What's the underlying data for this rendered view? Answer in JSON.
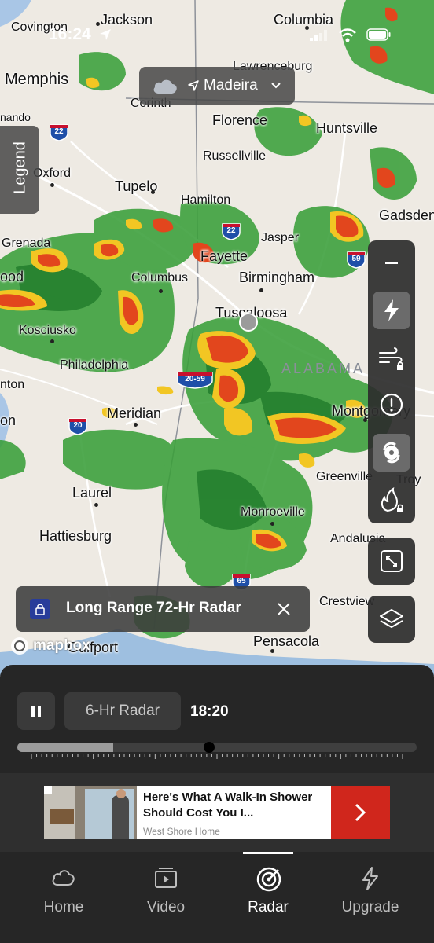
{
  "status_bar": {
    "time": "16:24"
  },
  "location": {
    "name": "Madeira"
  },
  "legend": {
    "label": "Legend"
  },
  "map": {
    "attribution": "mapbox",
    "state_label": "ALABAMA",
    "cities": [
      "Covington",
      "Jackson",
      "Columbia",
      "Lawrenceburg",
      "Memphis",
      "Corinth",
      "Florence",
      "Huntsville",
      "nando",
      "Russellville",
      "Oxford",
      "Tupelo",
      "Hamilton",
      "Gadsden",
      "Grenada",
      "Jasper",
      "Fayette",
      "ood",
      "Columbus",
      "Birmingham",
      "Tuscaloosa",
      "Kosciusko",
      "Philadelphia",
      "nton",
      "Meridian",
      "Montgomery",
      "on",
      "Greenville",
      "Troy",
      "Laurel",
      "Monroeville",
      "Hattiesburg",
      "Andalusia",
      "Crestview",
      "Pensacola",
      "Gulfport"
    ],
    "highways": [
      "22",
      "22",
      "59",
      "20-59",
      "20",
      "65"
    ]
  },
  "long_range": {
    "label": "Long Range 72-Hr Radar"
  },
  "controls": {
    "radar_mode": "6-Hr Radar",
    "time": "18:20",
    "progress": 0.24,
    "marker": 0.48
  },
  "ad": {
    "headline": "Here's What A Walk-In Shower Should Cost You I...",
    "advertiser": "West Shore Home"
  },
  "tabs": [
    "Home",
    "Video",
    "Radar",
    "Upgrade"
  ],
  "active_tab": "Radar",
  "colors": {
    "accent": "#ffffff",
    "ad_arrow": "#d0261c",
    "radar_green": "#3aa83a",
    "radar_red": "#e2461d",
    "radar_yellow": "#f2c623"
  }
}
